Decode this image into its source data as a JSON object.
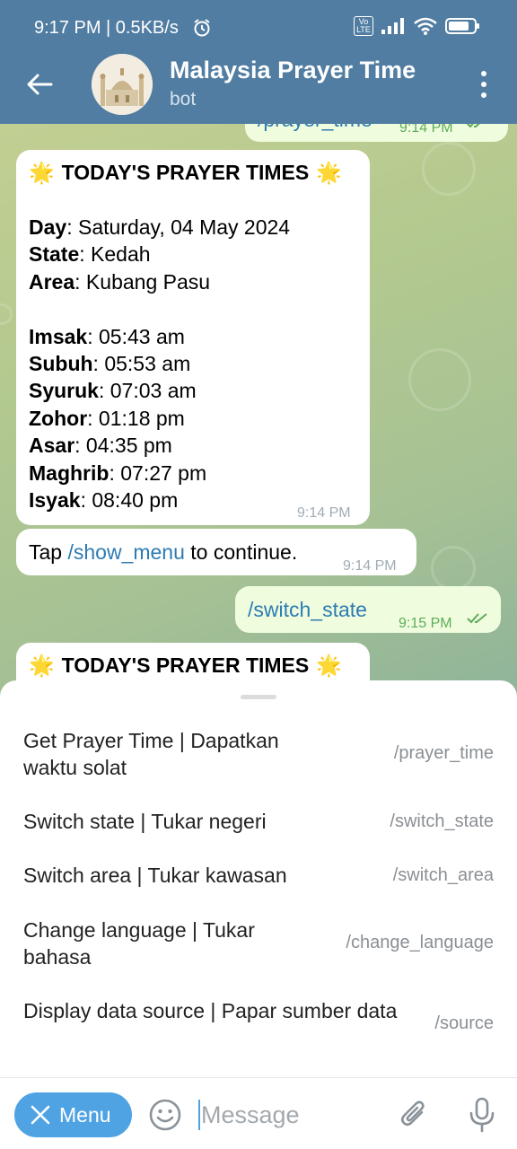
{
  "status_bar": {
    "time": "9:17 PM | 0.5KB/s",
    "volte": "Vo LTE"
  },
  "header": {
    "title": "Malaysia Prayer Time",
    "subtitle": "bot"
  },
  "messages": {
    "partial_out": {
      "text": "/prayer_time",
      "time": "9:14 PM"
    },
    "prayer_card": {
      "heading": "TODAY'S PRAYER TIMES",
      "day_label": "Day",
      "day_value": ": Saturday, 04 May 2024",
      "state_label": "State",
      "state_value": ": Kedah",
      "area_label": "Area",
      "area_value": ": Kubang Pasu",
      "imsak_label": "Imsak",
      "imsak_value": ": 05:43 am",
      "subuh_label": "Subuh",
      "subuh_value": ": 05:53 am",
      "syuruk_label": "Syuruk",
      "syuruk_value": ": 07:03 am",
      "zohor_label": "Zohor",
      "zohor_value": ": 01:18 pm",
      "asar_label": "Asar",
      "asar_value": ": 04:35 pm",
      "maghrib_label": "Maghrib",
      "maghrib_value": ": 07:27 pm",
      "isyak_label": "Isyak",
      "isyak_value": ": 08:40 pm",
      "time": "9:14 PM"
    },
    "tap_menu": {
      "prefix": "Tap ",
      "command": "/show_menu",
      "suffix": " to continue.",
      "time": "9:14 PM"
    },
    "switch_state_out": {
      "text": "/switch_state",
      "time": "9:15 PM"
    },
    "prayer_card_2": {
      "heading": "TODAY'S PRAYER TIMES"
    }
  },
  "command_menu": [
    {
      "description": "Get Prayer Time | Dapatkan waktu solat",
      "command": "/prayer_time"
    },
    {
      "description": "Switch state | Tukar negeri",
      "command": "/switch_state"
    },
    {
      "description": "Switch area | Tukar kawasan",
      "command": "/switch_area"
    },
    {
      "description": "Change language | Tukar bahasa",
      "command": "/change_language"
    },
    {
      "description": "Display data source | Papar sumber data",
      "command": "/source"
    }
  ],
  "input_bar": {
    "menu_label": "Menu",
    "placeholder": "Message"
  },
  "colors": {
    "header": "#517da2",
    "accent": "#4fa3e3",
    "outgoing_bubble": "#effdde",
    "link": "#2d7bb3"
  },
  "icons": [
    "back-arrow-icon",
    "alarm-icon",
    "signal-icon",
    "wifi-icon",
    "battery-icon",
    "more-vertical-icon",
    "star-emoji-icon",
    "double-check-icon",
    "close-icon",
    "emoji-icon",
    "paperclip-icon",
    "microphone-icon"
  ]
}
